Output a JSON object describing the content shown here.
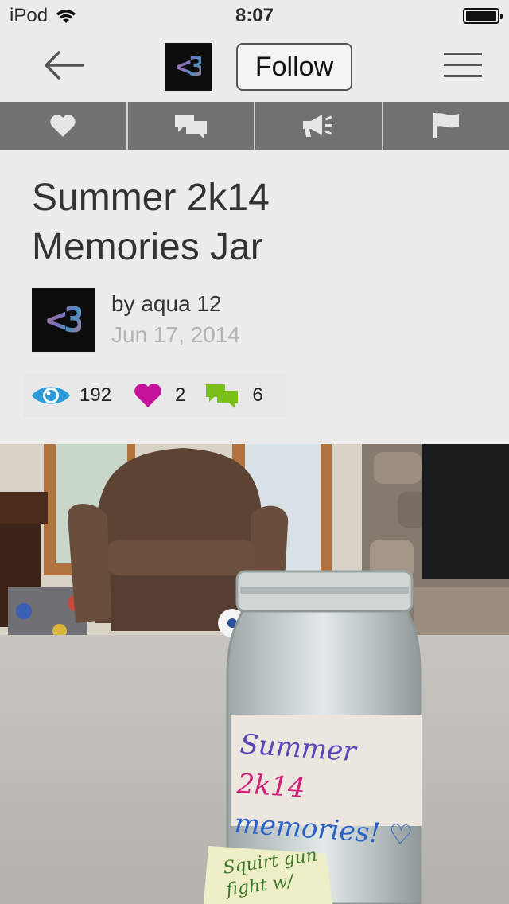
{
  "status_bar": {
    "carrier": "iPod",
    "time": "8:07"
  },
  "nav": {
    "avatar_text": "<3",
    "follow_label": "Follow"
  },
  "actions": [
    {
      "icon": "heart-icon"
    },
    {
      "icon": "comment-icon"
    },
    {
      "icon": "megaphone-icon"
    },
    {
      "icon": "flag-icon"
    }
  ],
  "post": {
    "title_line1": "Summer 2k14",
    "title_line2": "Memories Jar",
    "author": "by aqua 12",
    "date": "Jun 17, 2014",
    "author_avatar_text": "<3"
  },
  "stats": {
    "views": "192",
    "likes": "2",
    "comments": "6"
  },
  "colors": {
    "views": "#2b9bd8",
    "likes": "#c4129a",
    "comments": "#7bbf19"
  },
  "photo": {
    "label_line1a": "Summer",
    "label_line1b": "2k14",
    "label_line2": "memories! ♡",
    "note_line1": "Squirt gun",
    "note_line2": "fight w/"
  }
}
